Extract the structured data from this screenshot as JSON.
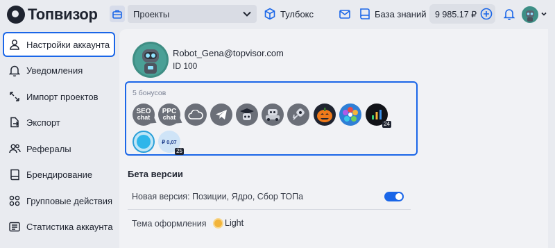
{
  "header": {
    "logo_text": "Топвизор",
    "projects_select_value": "Проекты",
    "toolbox_label": "Тулбокс",
    "knowledge_base_label": "База знаний",
    "balance": "9 985.17 ₽"
  },
  "sidebar": {
    "items": [
      {
        "label": "Настройки аккаунта",
        "icon": "user-icon",
        "active": true
      },
      {
        "label": "Уведомления",
        "icon": "bell-icon"
      },
      {
        "label": "Импорт проектов",
        "icon": "import-arrows-icon"
      },
      {
        "label": "Экспорт",
        "icon": "export-icon"
      },
      {
        "label": "Рефералы",
        "icon": "users-icon"
      },
      {
        "label": "Брендирование",
        "icon": "book-icon"
      },
      {
        "label": "Групповые действия",
        "icon": "grid-icon"
      },
      {
        "label": "Статистика аккаунта",
        "icon": "stats-icon"
      }
    ]
  },
  "profile": {
    "email": "Robot_Gena@topvisor.com",
    "id_text": "ID 100"
  },
  "bonuses": {
    "title": "5 бонусов",
    "badges": [
      {
        "name": "seo-chat-badge",
        "line1": "SEO",
        "line2": "chat"
      },
      {
        "name": "ppc-chat-badge",
        "line1": "PPC",
        "line2": "chat"
      },
      {
        "name": "cloud-badge"
      },
      {
        "name": "telegram-badge"
      },
      {
        "name": "graduate-robot-badge"
      },
      {
        "name": "robot-car-badge"
      },
      {
        "name": "robot-rocket-badge"
      },
      {
        "name": "pumpkin-badge"
      },
      {
        "name": "flower-badge"
      },
      {
        "name": "analytics-badge",
        "counter": "24"
      },
      {
        "name": "blue-circle-badge"
      },
      {
        "name": "ruble-badge",
        "value": "₽ 0,07",
        "counter": "25"
      }
    ]
  },
  "beta": {
    "title": "Бета версии",
    "new_version_label": "Новая версия: Позиции, Ядро, Сбор ТОПа",
    "new_version_enabled": true,
    "theme_label": "Тема оформления",
    "theme_value": "Light"
  },
  "colors": {
    "accent": "#1a66e8",
    "background": "#e9ebf0",
    "panel": "#f1f2f5"
  }
}
